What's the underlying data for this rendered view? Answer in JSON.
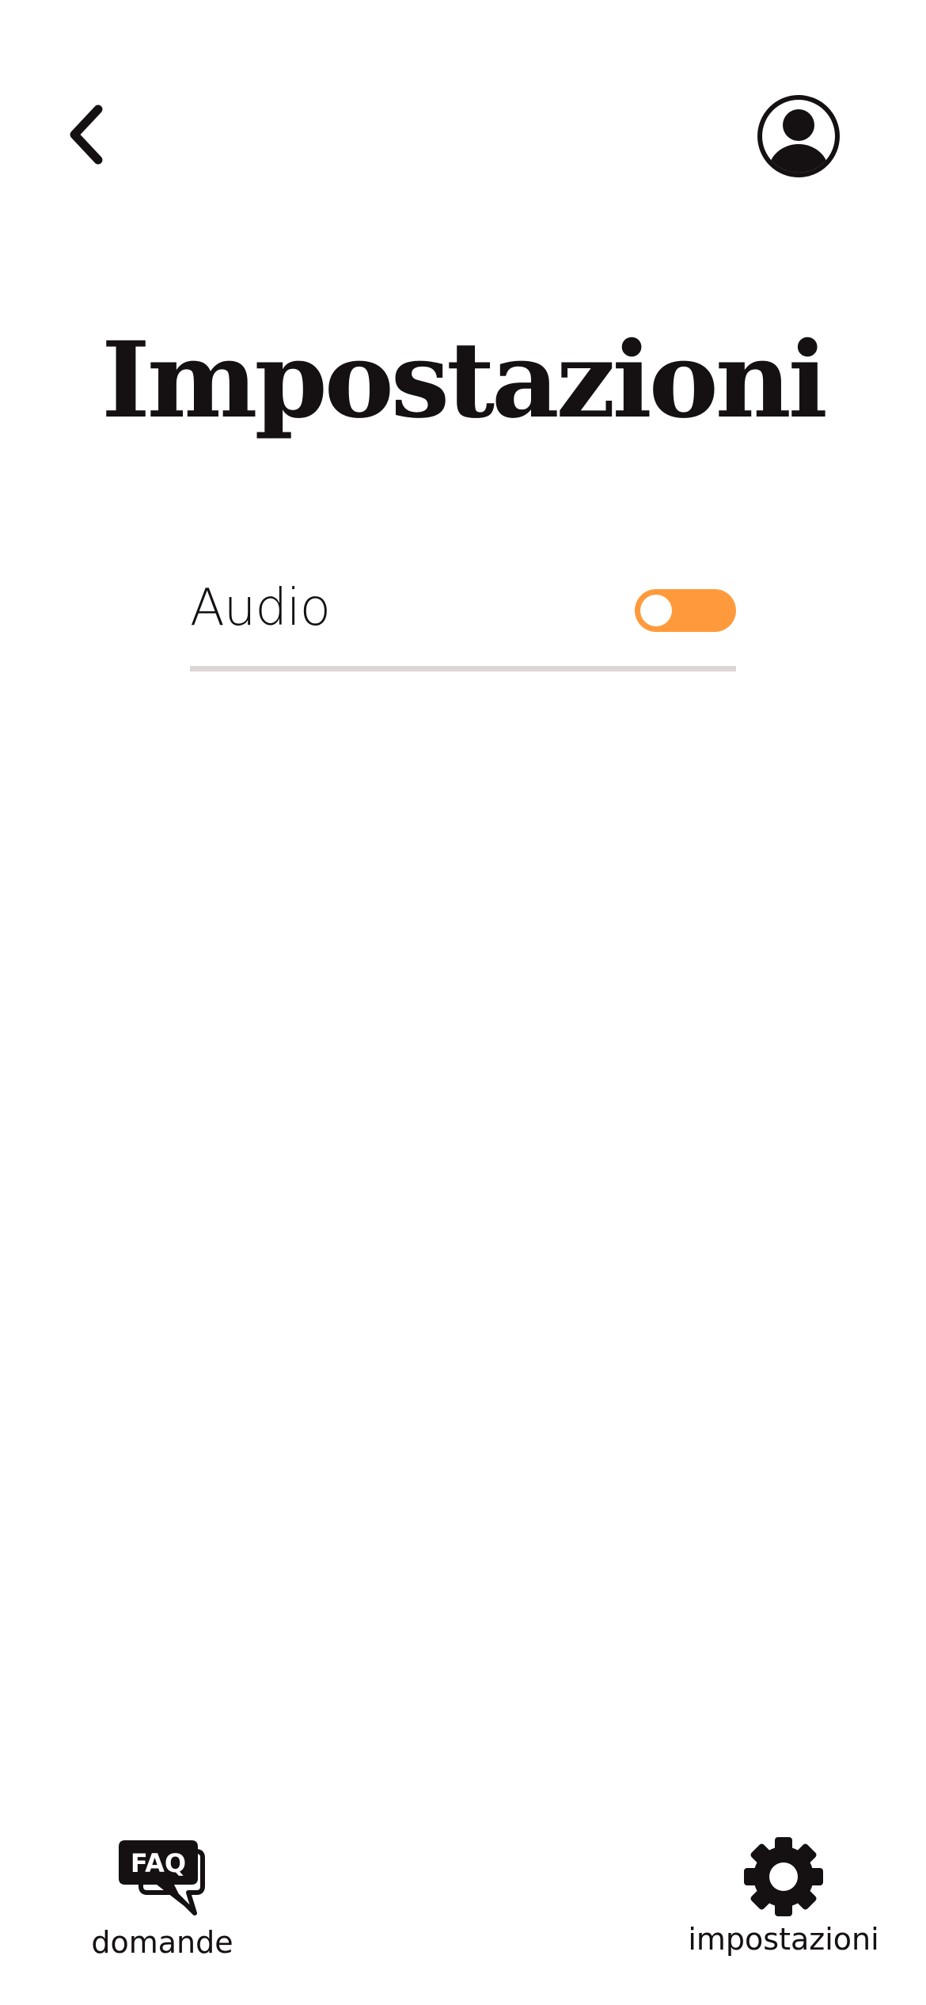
{
  "header": {
    "back_icon": "chevron-left-icon",
    "profile_icon": "user-circle-icon"
  },
  "page": {
    "title": "Impostazioni"
  },
  "settings": {
    "items": [
      {
        "label": "Audio",
        "control": "toggle",
        "state": "on",
        "accent_color": "#FF9A3C"
      }
    ],
    "divider_color": "#DCD6D6"
  },
  "bottom_nav": {
    "items": [
      {
        "icon": "faq-chat-icon",
        "icon_text": "FAQ",
        "label": "domande"
      },
      {
        "icon": "gear-icon",
        "label": "impostazioni"
      }
    ]
  },
  "colors": {
    "text": "#151112",
    "background": "#FFFFFF",
    "accent": "#FF9A3C"
  }
}
